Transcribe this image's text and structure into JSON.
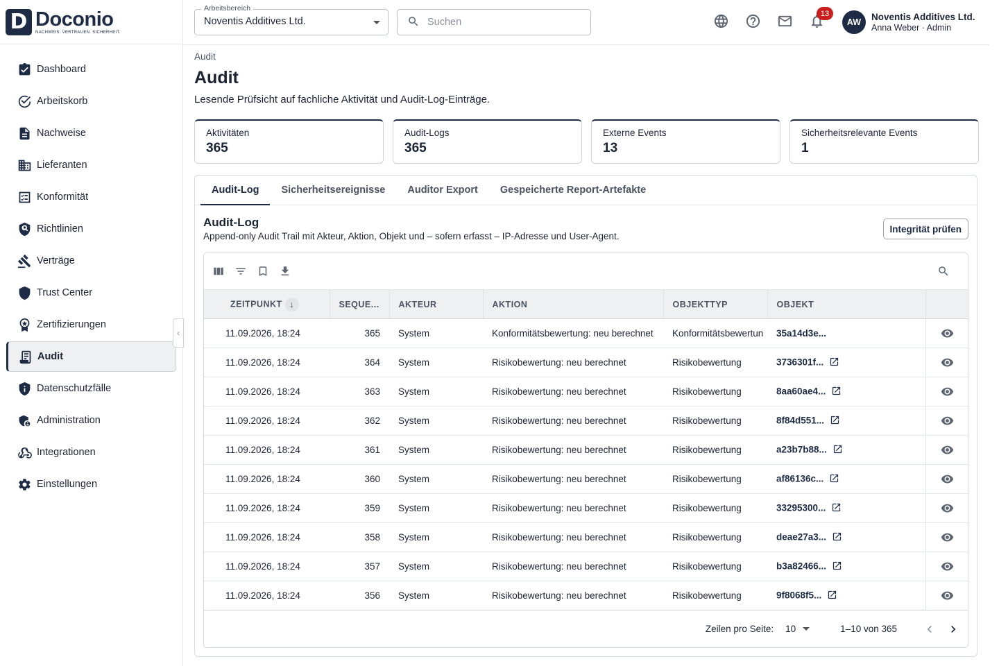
{
  "brand": {
    "initial": "D",
    "name": "Doconio",
    "tagline": "NACHWEIS. VERTRAUEN. SICHERHEIT."
  },
  "sidebar": {
    "items": [
      {
        "label": "Dashboard",
        "icon": "dashboard-icon"
      },
      {
        "label": "Arbeitskorb",
        "icon": "check-circle-icon"
      },
      {
        "label": "Nachweise",
        "icon": "document-icon"
      },
      {
        "label": "Lieferanten",
        "icon": "building-icon"
      },
      {
        "label": "Konformität",
        "icon": "checklist-icon"
      },
      {
        "label": "Richtlinien",
        "icon": "policy-shield-icon"
      },
      {
        "label": "Verträge",
        "icon": "gavel-icon"
      },
      {
        "label": "Trust Center",
        "icon": "shield-icon"
      },
      {
        "label": "Zertifizierungen",
        "icon": "award-icon"
      },
      {
        "label": "Audit",
        "icon": "audit-log-icon",
        "active": true
      },
      {
        "label": "Datenschutzfälle",
        "icon": "privacy-shield-icon"
      },
      {
        "label": "Administration",
        "icon": "admin-shield-icon"
      },
      {
        "label": "Integrationen",
        "icon": "webhook-icon"
      },
      {
        "label": "Einstellungen",
        "icon": "gear-icon"
      }
    ]
  },
  "header": {
    "workspace_label": "Arbeitsbereich",
    "workspace_value": "Noventis Additives Ltd.",
    "search_placeholder": "Suchen",
    "notification_count": "13",
    "avatar_initials": "AW",
    "user_org": "Noventis Additives Ltd.",
    "user_line": "Anna Weber · Admin"
  },
  "page": {
    "breadcrumb": "Audit",
    "title": "Audit",
    "subtitle": "Lesende Prüfsicht auf fachliche Aktivität und Audit-Log-Einträge."
  },
  "stats": [
    {
      "label": "Aktivitäten",
      "value": "365"
    },
    {
      "label": "Audit-Logs",
      "value": "365"
    },
    {
      "label": "Externe Events",
      "value": "13"
    },
    {
      "label": "Sicherheitsrelevante Events",
      "value": "1"
    }
  ],
  "tabs": [
    "Audit-Log",
    "Sicherheitsereignisse",
    "Auditor Export",
    "Gespeicherte Report-Artefakte"
  ],
  "section": {
    "title": "Audit-Log",
    "subtitle": "Append-only Audit Trail mit Akteur, Aktion, Objekt und – sofern erfasst – IP-Adresse und User-Agent.",
    "integrity_button": "Integrität prüfen"
  },
  "table": {
    "columns": [
      "ZEITPUNKT",
      "SEQUENZ",
      "AKTEUR",
      "AKTION",
      "OBJEKTTYP",
      "OBJEKT"
    ],
    "columns_display": [
      "ZEITPUNKT",
      "SEQUE...",
      "AKTEUR",
      "AKTION",
      "OBJEKTTYP",
      "OBJEKT"
    ],
    "rows": [
      {
        "time": "11.09.2026, 18:24",
        "seq": "365",
        "actor": "System",
        "action": "Konformitätsbewertung: neu berechnet",
        "type": "Konformitätsbewertun",
        "object": "35a14d3e...",
        "link": false
      },
      {
        "time": "11.09.2026, 18:24",
        "seq": "364",
        "actor": "System",
        "action": "Risikobewertung: neu berechnet",
        "type": "Risikobewertung",
        "object": "3736301f...",
        "link": true
      },
      {
        "time": "11.09.2026, 18:24",
        "seq": "363",
        "actor": "System",
        "action": "Risikobewertung: neu berechnet",
        "type": "Risikobewertung",
        "object": "8aa60ae4...",
        "link": true
      },
      {
        "time": "11.09.2026, 18:24",
        "seq": "362",
        "actor": "System",
        "action": "Risikobewertung: neu berechnet",
        "type": "Risikobewertung",
        "object": "8f84d551...",
        "link": true
      },
      {
        "time": "11.09.2026, 18:24",
        "seq": "361",
        "actor": "System",
        "action": "Risikobewertung: neu berechnet",
        "type": "Risikobewertung",
        "object": "a23b7b88...",
        "link": true
      },
      {
        "time": "11.09.2026, 18:24",
        "seq": "360",
        "actor": "System",
        "action": "Risikobewertung: neu berechnet",
        "type": "Risikobewertung",
        "object": "af86136c...",
        "link": true
      },
      {
        "time": "11.09.2026, 18:24",
        "seq": "359",
        "actor": "System",
        "action": "Risikobewertung: neu berechnet",
        "type": "Risikobewertung",
        "object": "33295300...",
        "link": true
      },
      {
        "time": "11.09.2026, 18:24",
        "seq": "358",
        "actor": "System",
        "action": "Risikobewertung: neu berechnet",
        "type": "Risikobewertung",
        "object": "deae27a3...",
        "link": true
      },
      {
        "time": "11.09.2026, 18:24",
        "seq": "357",
        "actor": "System",
        "action": "Risikobewertung: neu berechnet",
        "type": "Risikobewertung",
        "object": "b3a82466...",
        "link": true
      },
      {
        "time": "11.09.2026, 18:24",
        "seq": "356",
        "actor": "System",
        "action": "Risikobewertung: neu berechnet",
        "type": "Risikobewertung",
        "object": "9f8068f5...",
        "link": true
      }
    ]
  },
  "pagination": {
    "rows_per_page_label": "Zeilen pro Seite:",
    "rows_per_page": "10",
    "range": "1–10 von 365"
  },
  "colors": {
    "brand": "#1d2b45",
    "badge": "#c81e1e",
    "header_bg": "#eff0f2"
  }
}
